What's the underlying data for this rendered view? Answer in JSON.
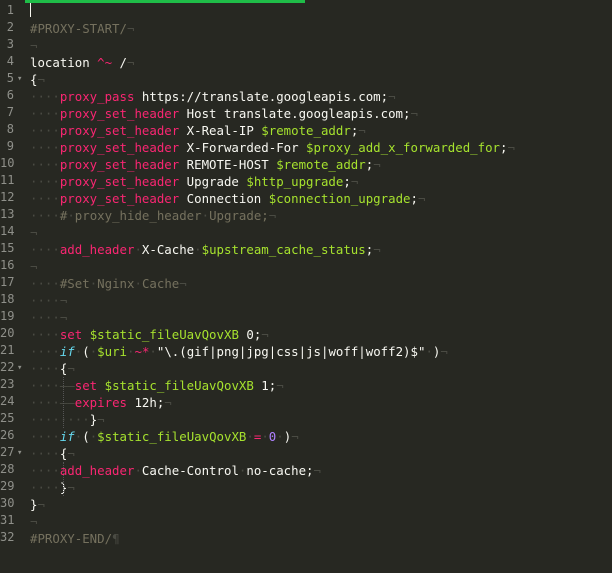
{
  "editor": {
    "theme": "monokai",
    "colors": {
      "background": "#272822",
      "tab_accent": "#1fbd48",
      "keyword": "#f92672",
      "variable": "#a6e22e",
      "string": "#e6db74",
      "number": "#ae81ff",
      "comment": "#75715e",
      "whitespace": "#4a4b43",
      "italic_keyword": "#66d9ef"
    },
    "lines": [
      {
        "n": "1",
        "fold": "",
        "segs": []
      },
      {
        "n": "2",
        "fold": "",
        "segs": [
          {
            "t": "#PROXY-START/",
            "c": "c"
          },
          {
            "t": "¬",
            "c": "ws"
          }
        ]
      },
      {
        "n": "3",
        "fold": "",
        "segs": [
          {
            "t": "¬",
            "c": "ws"
          }
        ]
      },
      {
        "n": "4",
        "fold": "",
        "segs": [
          {
            "t": "location",
            "c": "pl"
          },
          {
            "t": " ",
            "c": "ws"
          },
          {
            "t": "^~",
            "c": "kw"
          },
          {
            "t": " ",
            "c": "ws"
          },
          {
            "t": "/",
            "c": "pl"
          },
          {
            "t": "¬",
            "c": "ws"
          }
        ]
      },
      {
        "n": "5",
        "fold": "▾",
        "segs": [
          {
            "t": "{",
            "c": "pl"
          },
          {
            "t": "¬",
            "c": "ws"
          }
        ]
      },
      {
        "n": "6",
        "fold": "",
        "segs": [
          {
            "t": "····",
            "c": "ws"
          },
          {
            "t": "proxy_pass",
            "c": "kw"
          },
          {
            "t": " ",
            "c": "ws"
          },
          {
            "t": "https://translate.googleapis.com;",
            "c": "pl"
          },
          {
            "t": "¬",
            "c": "ws"
          }
        ]
      },
      {
        "n": "7",
        "fold": "",
        "segs": [
          {
            "t": "····",
            "c": "ws"
          },
          {
            "t": "proxy_set_header",
            "c": "kw"
          },
          {
            "t": " ",
            "c": "ws"
          },
          {
            "t": "Host",
            "c": "pl"
          },
          {
            "t": " ",
            "c": "ws"
          },
          {
            "t": "translate.googleapis.com;",
            "c": "pl"
          },
          {
            "t": "¬",
            "c": "ws"
          }
        ]
      },
      {
        "n": "8",
        "fold": "",
        "segs": [
          {
            "t": "····",
            "c": "ws"
          },
          {
            "t": "proxy_set_header",
            "c": "kw"
          },
          {
            "t": " ",
            "c": "ws"
          },
          {
            "t": "X-Real-IP",
            "c": "pl"
          },
          {
            "t": " ",
            "c": "ws"
          },
          {
            "t": "$remote_addr",
            "c": "vr"
          },
          {
            "t": ";",
            "c": "pl"
          },
          {
            "t": "¬",
            "c": "ws"
          }
        ]
      },
      {
        "n": "9",
        "fold": "",
        "segs": [
          {
            "t": "····",
            "c": "ws"
          },
          {
            "t": "proxy_set_header",
            "c": "kw"
          },
          {
            "t": " ",
            "c": "ws"
          },
          {
            "t": "X-Forwarded-For",
            "c": "pl"
          },
          {
            "t": " ",
            "c": "ws"
          },
          {
            "t": "$proxy_add_x_forwarded_for",
            "c": "vr"
          },
          {
            "t": ";",
            "c": "pl"
          },
          {
            "t": "¬",
            "c": "ws"
          }
        ]
      },
      {
        "n": "10",
        "fold": "",
        "segs": [
          {
            "t": "····",
            "c": "ws"
          },
          {
            "t": "proxy_set_header",
            "c": "kw"
          },
          {
            "t": " ",
            "c": "ws"
          },
          {
            "t": "REMOTE-HOST",
            "c": "pl"
          },
          {
            "t": " ",
            "c": "ws"
          },
          {
            "t": "$remote_addr",
            "c": "vr"
          },
          {
            "t": ";",
            "c": "pl"
          },
          {
            "t": "¬",
            "c": "ws"
          }
        ]
      },
      {
        "n": "11",
        "fold": "",
        "segs": [
          {
            "t": "····",
            "c": "ws"
          },
          {
            "t": "proxy_set_header",
            "c": "kw"
          },
          {
            "t": " ",
            "c": "ws"
          },
          {
            "t": "Upgrade",
            "c": "pl"
          },
          {
            "t": " ",
            "c": "ws"
          },
          {
            "t": "$http_upgrade",
            "c": "vr"
          },
          {
            "t": ";",
            "c": "pl"
          },
          {
            "t": "¬",
            "c": "ws"
          }
        ]
      },
      {
        "n": "12",
        "fold": "",
        "segs": [
          {
            "t": "····",
            "c": "ws"
          },
          {
            "t": "proxy_set_header",
            "c": "kw"
          },
          {
            "t": " ",
            "c": "ws"
          },
          {
            "t": "Connection",
            "c": "pl"
          },
          {
            "t": " ",
            "c": "ws"
          },
          {
            "t": "$connection_upgrade",
            "c": "vr"
          },
          {
            "t": ";",
            "c": "pl"
          },
          {
            "t": "¬",
            "c": "ws"
          }
        ]
      },
      {
        "n": "13",
        "fold": "",
        "segs": [
          {
            "t": "····",
            "c": "ws"
          },
          {
            "t": "#",
            "c": "c"
          },
          {
            "t": "·",
            "c": "ws"
          },
          {
            "t": "proxy_hide_header",
            "c": "c"
          },
          {
            "t": "·",
            "c": "ws"
          },
          {
            "t": "Upgrade;",
            "c": "c"
          },
          {
            "t": "¬",
            "c": "ws"
          }
        ]
      },
      {
        "n": "14",
        "fold": "",
        "segs": [
          {
            "t": "¬",
            "c": "ws"
          }
        ]
      },
      {
        "n": "15",
        "fold": "",
        "segs": [
          {
            "t": "····",
            "c": "ws"
          },
          {
            "t": "add_header",
            "c": "kw"
          },
          {
            "t": "·",
            "c": "ws"
          },
          {
            "t": "X-Cache",
            "c": "pl"
          },
          {
            "t": "·",
            "c": "ws"
          },
          {
            "t": "$upstream_cache_status",
            "c": "vr"
          },
          {
            "t": ";",
            "c": "pl"
          },
          {
            "t": "¬",
            "c": "ws"
          }
        ]
      },
      {
        "n": "16",
        "fold": "",
        "segs": [
          {
            "t": "¬",
            "c": "ws"
          }
        ]
      },
      {
        "n": "17",
        "fold": "",
        "segs": [
          {
            "t": "····",
            "c": "ws"
          },
          {
            "t": "#Set",
            "c": "c"
          },
          {
            "t": "·",
            "c": "ws"
          },
          {
            "t": "Nginx",
            "c": "c"
          },
          {
            "t": "·",
            "c": "ws"
          },
          {
            "t": "Cache",
            "c": "c"
          },
          {
            "t": "¬",
            "c": "ws"
          }
        ]
      },
      {
        "n": "18",
        "fold": "",
        "segs": [
          {
            "t": "····¬",
            "c": "ws"
          }
        ]
      },
      {
        "n": "19",
        "fold": "",
        "segs": [
          {
            "t": "····¬",
            "c": "ws"
          }
        ]
      },
      {
        "n": "20",
        "fold": "",
        "segs": [
          {
            "t": "····",
            "c": "ws"
          },
          {
            "t": "set",
            "c": "kw"
          },
          {
            "t": " ",
            "c": "ws"
          },
          {
            "t": "$static_fileUavQovXB",
            "c": "vr"
          },
          {
            "t": " ",
            "c": "ws"
          },
          {
            "t": "0;",
            "c": "pl"
          },
          {
            "t": "¬",
            "c": "ws"
          }
        ]
      },
      {
        "n": "21",
        "fold": "",
        "segs": [
          {
            "t": "····",
            "c": "ws"
          },
          {
            "t": "if",
            "c": "it"
          },
          {
            "t": "·",
            "c": "ws"
          },
          {
            "t": "(",
            "c": "pl"
          },
          {
            "t": "·",
            "c": "ws"
          },
          {
            "t": "$uri",
            "c": "vr"
          },
          {
            "t": "·",
            "c": "ws"
          },
          {
            "t": "~*",
            "c": "kw"
          },
          {
            "t": "·",
            "c": "ws"
          },
          {
            "t": "\"\\.(gif|png|jpg|css|js|woff|woff2)$\"",
            "c": "pl"
          },
          {
            "t": "·",
            "c": "ws"
          },
          {
            "t": ")",
            "c": "pl"
          },
          {
            "t": "¬",
            "c": "ws"
          }
        ]
      },
      {
        "n": "22",
        "fold": "▾",
        "segs": [
          {
            "t": "····",
            "c": "ws"
          },
          {
            "t": "{",
            "c": "pl"
          },
          {
            "t": "¬",
            "c": "ws"
          }
        ]
      },
      {
        "n": "23",
        "fold": "",
        "segs": [
          {
            "t": "····——",
            "c": "ws"
          },
          {
            "t": "set",
            "c": "kw"
          },
          {
            "t": " ",
            "c": "ws"
          },
          {
            "t": "$static_fileUavQovXB",
            "c": "vr"
          },
          {
            "t": " ",
            "c": "ws"
          },
          {
            "t": "1;",
            "c": "pl"
          },
          {
            "t": "¬",
            "c": "ws"
          }
        ]
      },
      {
        "n": "24",
        "fold": "",
        "segs": [
          {
            "t": "····——",
            "c": "ws"
          },
          {
            "t": "expires",
            "c": "kw"
          },
          {
            "t": " ",
            "c": "ws"
          },
          {
            "t": "12h;",
            "c": "pl"
          },
          {
            "t": "¬",
            "c": "ws"
          }
        ]
      },
      {
        "n": "25",
        "fold": "",
        "segs": [
          {
            "t": "········",
            "c": "ws"
          },
          {
            "t": "}",
            "c": "pl"
          },
          {
            "t": "¬",
            "c": "ws"
          }
        ]
      },
      {
        "n": "26",
        "fold": "",
        "segs": [
          {
            "t": "····",
            "c": "ws"
          },
          {
            "t": "if",
            "c": "it"
          },
          {
            "t": "·",
            "c": "ws"
          },
          {
            "t": "(",
            "c": "pl"
          },
          {
            "t": "·",
            "c": "ws"
          },
          {
            "t": "$static_fileUavQovXB",
            "c": "vr"
          },
          {
            "t": "·",
            "c": "ws"
          },
          {
            "t": "=",
            "c": "kw"
          },
          {
            "t": "·",
            "c": "ws"
          },
          {
            "t": "0",
            "c": "nm"
          },
          {
            "t": "·",
            "c": "ws"
          },
          {
            "t": ")",
            "c": "pl"
          },
          {
            "t": "¬",
            "c": "ws"
          }
        ]
      },
      {
        "n": "27",
        "fold": "▾",
        "segs": [
          {
            "t": "····",
            "c": "ws"
          },
          {
            "t": "{",
            "c": "pl"
          },
          {
            "t": "¬",
            "c": "ws"
          }
        ]
      },
      {
        "n": "28",
        "fold": "",
        "segs": [
          {
            "t": "····",
            "c": "ws"
          },
          {
            "t": "add_header",
            "c": "kw"
          },
          {
            "t": "·",
            "c": "ws"
          },
          {
            "t": "Cache-Control",
            "c": "pl"
          },
          {
            "t": "·",
            "c": "ws"
          },
          {
            "t": "no-cache;",
            "c": "pl"
          },
          {
            "t": "¬",
            "c": "ws"
          }
        ]
      },
      {
        "n": "29",
        "fold": "",
        "segs": [
          {
            "t": "····",
            "c": "ws"
          },
          {
            "t": "}",
            "c": "pl"
          },
          {
            "t": "¬",
            "c": "ws"
          }
        ]
      },
      {
        "n": "30",
        "fold": "",
        "segs": [
          {
            "t": "}",
            "c": "pl"
          },
          {
            "t": "¬",
            "c": "ws"
          }
        ]
      },
      {
        "n": "31",
        "fold": "",
        "segs": [
          {
            "t": "¬",
            "c": "ws"
          }
        ]
      },
      {
        "n": "32",
        "fold": "",
        "segs": [
          {
            "t": "#PROXY-END/",
            "c": "c"
          },
          {
            "t": "¶",
            "c": "ws"
          }
        ]
      }
    ]
  }
}
